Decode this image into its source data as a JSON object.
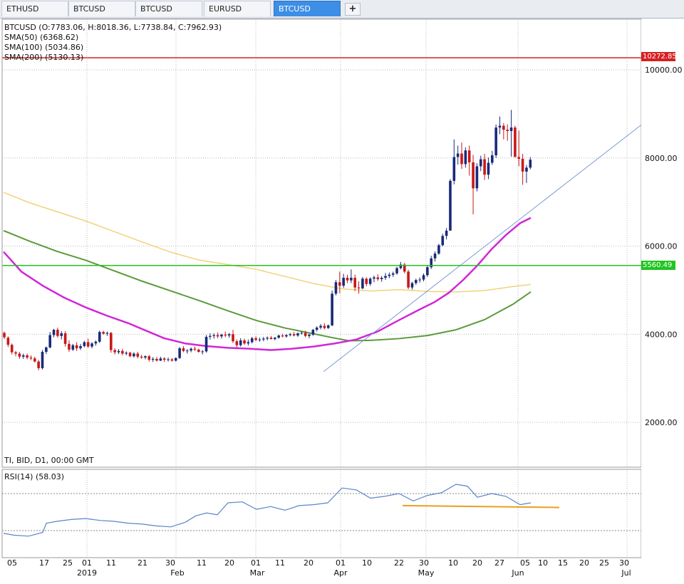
{
  "tabs": [
    {
      "label": "ETHUSD",
      "active": false
    },
    {
      "label": "BTCUSD",
      "active": false
    },
    {
      "label": "BTCUSD",
      "active": false
    },
    {
      "label": "EURUSD",
      "active": false
    },
    {
      "label": "BTCUSD",
      "active": true
    }
  ],
  "add_tab_symbol": "+",
  "legend": {
    "ohlc": "BTCUSD (O:7783.06, H:8018.36, L:7738.84, C:7962.93)",
    "sma50": "SMA(50) (6368.62)",
    "sma100": "SMA(100) (5034.86)",
    "sma200": "SMA(200) (5130.13)"
  },
  "timeframe": "TI, BID, D1, 00:00 GMT",
  "rsi_label": "RSI(14) (58.03)",
  "levels": {
    "resistance": "10272.85",
    "support": "5560.49",
    "resistance_color": "#d62020",
    "support_color": "#22c422"
  },
  "colors": {
    "bull": "#1a2a7a",
    "bear": "#c81818",
    "sma50": "#d126d8",
    "sma100": "#5a9a3a",
    "sma200": "#f2d27a",
    "trendline": "#7d9ad6",
    "rsi": "#5a84c8",
    "rsi_support": "#e8a020"
  },
  "chart_data": {
    "type": "candlestick",
    "symbol": "BTCUSD",
    "ylim": [
      1000,
      11000
    ],
    "y_ticks": [
      "2000.00",
      "4000.00",
      "6000.00",
      "8000.00",
      "10000.00"
    ],
    "x_ticks": [
      "05",
      "17",
      "25",
      "01",
      "11",
      "21",
      "30",
      "11",
      "20",
      "01",
      "11",
      "20",
      "01",
      "10",
      "22",
      "30",
      "10",
      "20",
      "27",
      "05",
      "10",
      "15",
      "20",
      "25",
      "30"
    ],
    "x_month_labels": [
      "2019",
      "Feb",
      "Mar",
      "Apr",
      "May",
      "Jun",
      "Jul"
    ],
    "ohlc": [
      [
        4030,
        4060,
        3890,
        3930
      ],
      [
        3920,
        3950,
        3710,
        3760
      ],
      [
        3760,
        3790,
        3540,
        3590
      ],
      [
        3590,
        3620,
        3500,
        3560
      ],
      [
        3560,
        3600,
        3440,
        3490
      ],
      [
        3490,
        3560,
        3440,
        3520
      ],
      [
        3520,
        3560,
        3430,
        3470
      ],
      [
        3470,
        3520,
        3410,
        3450
      ],
      [
        3450,
        3490,
        3360,
        3380
      ],
      [
        3380,
        3420,
        3180,
        3230
      ],
      [
        3230,
        3640,
        3200,
        3600
      ],
      [
        3600,
        3720,
        3550,
        3700
      ],
      [
        3700,
        4050,
        3680,
        3980
      ],
      [
        3980,
        4120,
        3930,
        4100
      ],
      [
        4100,
        4150,
        3920,
        3960
      ],
      [
        3960,
        4070,
        3880,
        4020
      ],
      [
        4020,
        4070,
        3720,
        3780
      ],
      [
        3780,
        3860,
        3600,
        3650
      ],
      [
        3650,
        3780,
        3620,
        3750
      ],
      [
        3750,
        3820,
        3620,
        3680
      ],
      [
        3680,
        3780,
        3640,
        3730
      ],
      [
        3730,
        3850,
        3700,
        3820
      ],
      [
        3820,
        3900,
        3690,
        3720
      ],
      [
        3720,
        3820,
        3680,
        3790
      ],
      [
        3790,
        3860,
        3740,
        3830
      ],
      [
        3830,
        4080,
        3800,
        4050
      ],
      [
        4050,
        4080,
        3990,
        4010
      ],
      [
        4010,
        4060,
        3960,
        4030
      ],
      [
        4030,
        4050,
        3580,
        3640
      ],
      [
        3640,
        3680,
        3540,
        3590
      ],
      [
        3590,
        3660,
        3550,
        3620
      ],
      [
        3620,
        3670,
        3520,
        3560
      ],
      [
        3560,
        3610,
        3520,
        3580
      ],
      [
        3580,
        3600,
        3480,
        3500
      ],
      [
        3500,
        3590,
        3470,
        3560
      ],
      [
        3560,
        3600,
        3450,
        3490
      ],
      [
        3490,
        3530,
        3440,
        3470
      ],
      [
        3470,
        3520,
        3430,
        3500
      ],
      [
        3500,
        3530,
        3380,
        3420
      ],
      [
        3420,
        3480,
        3370,
        3440
      ],
      [
        3440,
        3480,
        3380,
        3400
      ],
      [
        3400,
        3490,
        3390,
        3450
      ],
      [
        3450,
        3480,
        3370,
        3420
      ],
      [
        3420,
        3470,
        3380,
        3430
      ],
      [
        3430,
        3460,
        3380,
        3400
      ],
      [
        3400,
        3470,
        3380,
        3460
      ],
      [
        3460,
        3710,
        3440,
        3680
      ],
      [
        3680,
        3730,
        3590,
        3620
      ],
      [
        3620,
        3660,
        3560,
        3630
      ],
      [
        3630,
        3700,
        3590,
        3670
      ],
      [
        3670,
        3720,
        3620,
        3650
      ],
      [
        3650,
        3670,
        3580,
        3600
      ],
      [
        3600,
        3640,
        3540,
        3610
      ],
      [
        3610,
        3980,
        3580,
        3940
      ],
      [
        3940,
        4020,
        3880,
        3960
      ],
      [
        3960,
        4020,
        3900,
        3980
      ],
      [
        3980,
        4040,
        3910,
        3950
      ],
      [
        3950,
        4010,
        3900,
        3990
      ],
      [
        3990,
        4060,
        3930,
        3970
      ],
      [
        3970,
        4030,
        3920,
        4000
      ],
      [
        4000,
        4100,
        3800,
        3840
      ],
      [
        3840,
        3880,
        3700,
        3750
      ],
      [
        3750,
        3910,
        3720,
        3860
      ],
      [
        3860,
        3900,
        3760,
        3790
      ],
      [
        3790,
        3880,
        3740,
        3820
      ],
      [
        3820,
        3940,
        3790,
        3910
      ],
      [
        3910,
        3950,
        3840,
        3870
      ],
      [
        3870,
        3920,
        3830,
        3880
      ],
      [
        3880,
        3940,
        3840,
        3900
      ],
      [
        3900,
        3950,
        3860,
        3920
      ],
      [
        3920,
        3960,
        3880,
        3890
      ],
      [
        3890,
        3940,
        3860,
        3920
      ],
      [
        3920,
        3990,
        3900,
        3970
      ],
      [
        3970,
        4010,
        3930,
        3950
      ],
      [
        3950,
        4000,
        3920,
        3980
      ],
      [
        3980,
        4030,
        3950,
        4000
      ],
      [
        4000,
        4050,
        3950,
        3970
      ],
      [
        3970,
        4040,
        3940,
        4020
      ],
      [
        4020,
        4070,
        3990,
        4030
      ],
      [
        4030,
        4080,
        3930,
        3960
      ],
      [
        3960,
        4010,
        3910,
        3990
      ],
      [
        3990,
        4120,
        3960,
        4100
      ],
      [
        4100,
        4180,
        4060,
        4150
      ],
      [
        4150,
        4230,
        4110,
        4190
      ],
      [
        4190,
        4250,
        4110,
        4140
      ],
      [
        4140,
        4220,
        4120,
        4200
      ],
      [
        4200,
        4990,
        4180,
        4920
      ],
      [
        4920,
        5230,
        4880,
        5180
      ],
      [
        5180,
        5420,
        4930,
        5100
      ],
      [
        5100,
        5370,
        5050,
        5280
      ],
      [
        5280,
        5350,
        5160,
        5220
      ],
      [
        5220,
        5470,
        5160,
        5280
      ],
      [
        5280,
        5350,
        4980,
        5060
      ],
      [
        5060,
        5200,
        4920,
        5040
      ],
      [
        5040,
        5300,
        5020,
        5260
      ],
      [
        5260,
        5290,
        5090,
        5140
      ],
      [
        5140,
        5290,
        5100,
        5260
      ],
      [
        5260,
        5330,
        5180,
        5290
      ],
      [
        5290,
        5360,
        5210,
        5250
      ],
      [
        5250,
        5320,
        5190,
        5280
      ],
      [
        5280,
        5390,
        5230,
        5320
      ],
      [
        5320,
        5400,
        5270,
        5350
      ],
      [
        5350,
        5420,
        5300,
        5380
      ],
      [
        5380,
        5530,
        5350,
        5500
      ],
      [
        5500,
        5640,
        5470,
        5580
      ],
      [
        5580,
        5620,
        5380,
        5420
      ],
      [
        5420,
        5460,
        5020,
        5060
      ],
      [
        5060,
        5190,
        5010,
        5160
      ],
      [
        5160,
        5260,
        5120,
        5230
      ],
      [
        5230,
        5290,
        5170,
        5240
      ],
      [
        5240,
        5380,
        5200,
        5340
      ],
      [
        5340,
        5560,
        5300,
        5520
      ],
      [
        5520,
        5780,
        5480,
        5720
      ],
      [
        5720,
        5880,
        5650,
        5830
      ],
      [
        5830,
        6050,
        5800,
        6020
      ],
      [
        6020,
        6280,
        5990,
        6230
      ],
      [
        6230,
        6410,
        6150,
        6350
      ],
      [
        6350,
        7520,
        6880,
        7480
      ],
      [
        7480,
        8420,
        7400,
        8020
      ],
      [
        8020,
        8280,
        7850,
        8100
      ],
      [
        8100,
        8350,
        7750,
        7860
      ],
      [
        7860,
        8240,
        7780,
        8170
      ],
      [
        8170,
        8280,
        7600,
        7900
      ],
      [
        7900,
        8070,
        6720,
        7310
      ],
      [
        7310,
        7880,
        7240,
        7810
      ],
      [
        7810,
        8050,
        7700,
        7970
      ],
      [
        7970,
        8090,
        7500,
        7620
      ],
      [
        7620,
        8010,
        7520,
        7890
      ],
      [
        7890,
        8160,
        7840,
        8060
      ],
      [
        8060,
        8760,
        8000,
        8690
      ],
      [
        8690,
        8940,
        8540,
        8730
      ],
      [
        8730,
        8790,
        8420,
        8640
      ],
      [
        8640,
        8760,
        8390,
        8610
      ],
      [
        8610,
        9090,
        8030,
        8690
      ],
      [
        8690,
        8730,
        8090,
        8020
      ],
      [
        8020,
        8620,
        7810,
        7980
      ],
      [
        7980,
        8090,
        7390,
        7690
      ],
      [
        7690,
        7840,
        7430,
        7780
      ],
      [
        7780,
        8020,
        7740,
        7960
      ]
    ],
    "ohlc_start_x": 6,
    "ohlc_step": 5.35,
    "sma_lines": {
      "sma50": [
        [
          5,
          5870
        ],
        [
          30,
          5420
        ],
        [
          60,
          5100
        ],
        [
          90,
          4830
        ],
        [
          120,
          4610
        ],
        [
          150,
          4420
        ],
        [
          180,
          4250
        ],
        [
          205,
          4080
        ],
        [
          230,
          3910
        ],
        [
          260,
          3790
        ],
        [
          290,
          3730
        ],
        [
          320,
          3690
        ],
        [
          350,
          3670
        ],
        [
          380,
          3640
        ],
        [
          410,
          3670
        ],
        [
          440,
          3720
        ],
        [
          470,
          3790
        ],
        [
          500,
          3880
        ],
        [
          530,
          4060
        ],
        [
          560,
          4320
        ],
        [
          590,
          4570
        ],
        [
          610,
          4730
        ],
        [
          630,
          4940
        ],
        [
          650,
          5230
        ],
        [
          670,
          5560
        ],
        [
          690,
          5930
        ],
        [
          710,
          6250
        ],
        [
          730,
          6520
        ],
        [
          745,
          6640
        ]
      ],
      "sma100": [
        [
          5,
          6350
        ],
        [
          40,
          6120
        ],
        [
          80,
          5880
        ],
        [
          120,
          5680
        ],
        [
          160,
          5440
        ],
        [
          200,
          5200
        ],
        [
          240,
          4980
        ],
        [
          280,
          4760
        ],
        [
          320,
          4530
        ],
        [
          360,
          4310
        ],
        [
          400,
          4140
        ],
        [
          440,
          4010
        ],
        [
          470,
          3910
        ],
        [
          490,
          3850
        ],
        [
          520,
          3860
        ],
        [
          560,
          3900
        ],
        [
          600,
          3970
        ],
        [
          640,
          4100
        ],
        [
          680,
          4330
        ],
        [
          720,
          4680
        ],
        [
          745,
          4960
        ]
      ],
      "sma200": [
        [
          5,
          7220
        ],
        [
          40,
          6990
        ],
        [
          80,
          6780
        ],
        [
          120,
          6570
        ],
        [
          160,
          6330
        ],
        [
          200,
          6090
        ],
        [
          240,
          5860
        ],
        [
          280,
          5680
        ],
        [
          320,
          5580
        ],
        [
          360,
          5470
        ],
        [
          400,
          5310
        ],
        [
          440,
          5150
        ],
        [
          480,
          5030
        ],
        [
          520,
          4980
        ],
        [
          560,
          5010
        ],
        [
          600,
          4970
        ],
        [
          640,
          4960
        ],
        [
          680,
          4990
        ],
        [
          720,
          5080
        ],
        [
          745,
          5130
        ]
      ]
    },
    "trendline": [
      [
        454,
        3150
      ],
      [
        900,
        8750
      ]
    ],
    "horizontal_levels": [
      10272.85,
      5560.49
    ],
    "rsi": {
      "ylim": [
        10,
        100
      ],
      "levels": [
        "70.00",
        "30.00"
      ],
      "series": [
        [
          5,
          27
        ],
        [
          20,
          25
        ],
        [
          40,
          24
        ],
        [
          60,
          28
        ],
        [
          65,
          38
        ],
        [
          80,
          40
        ],
        [
          100,
          42
        ],
        [
          120,
          43
        ],
        [
          140,
          41
        ],
        [
          160,
          40
        ],
        [
          180,
          38
        ],
        [
          200,
          37
        ],
        [
          220,
          35
        ],
        [
          240,
          34
        ],
        [
          260,
          39
        ],
        [
          275,
          46
        ],
        [
          290,
          49
        ],
        [
          305,
          47
        ],
        [
          320,
          60
        ],
        [
          340,
          61
        ],
        [
          360,
          53
        ],
        [
          380,
          56
        ],
        [
          400,
          52
        ],
        [
          420,
          57
        ],
        [
          440,
          58
        ],
        [
          460,
          60
        ],
        [
          480,
          76
        ],
        [
          500,
          74
        ],
        [
          520,
          65
        ],
        [
          540,
          67
        ],
        [
          560,
          70
        ],
        [
          580,
          62
        ],
        [
          600,
          68
        ],
        [
          620,
          71
        ],
        [
          640,
          80
        ],
        [
          656,
          78
        ],
        [
          670,
          66
        ],
        [
          690,
          70
        ],
        [
          710,
          67
        ],
        [
          730,
          58
        ],
        [
          745,
          60
        ]
      ],
      "support": [
        [
          565,
          57
        ],
        [
          785,
          55
        ]
      ]
    }
  }
}
